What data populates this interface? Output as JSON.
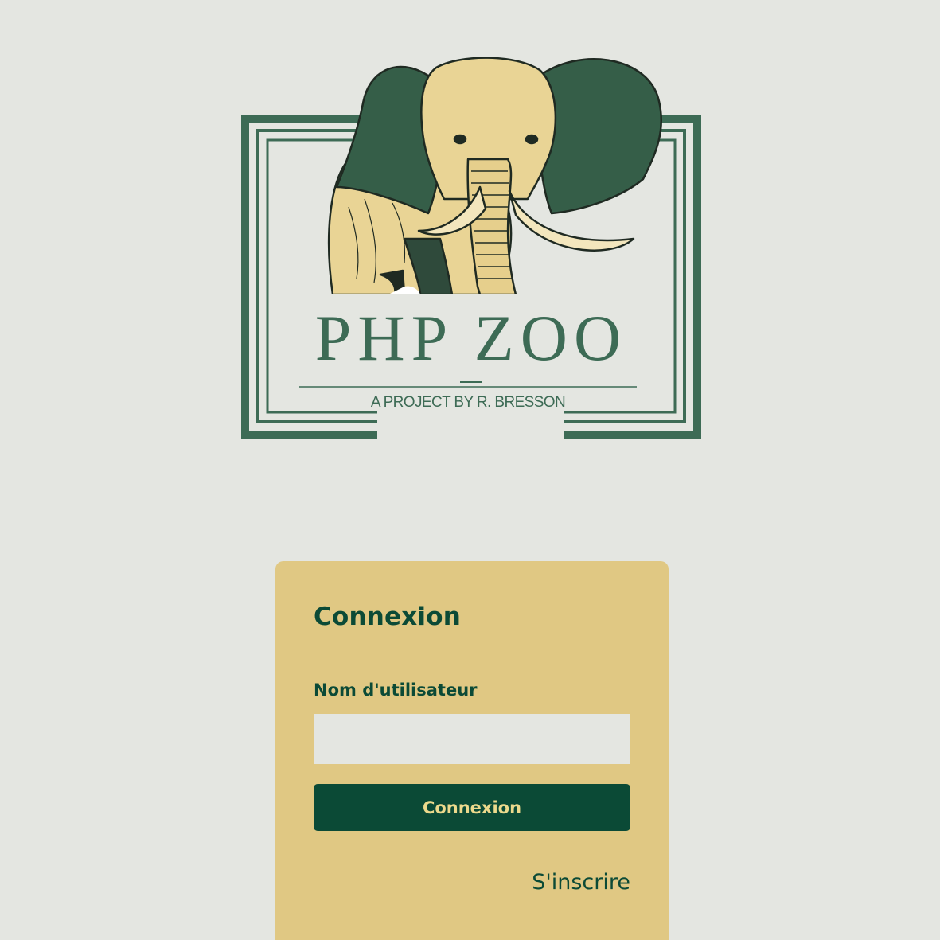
{
  "logo": {
    "title": "PHP ZOO",
    "subtitle": "A PROJECT BY R. BRESSON",
    "colors": {
      "frame": "#3d6b55",
      "ears": "#355e48",
      "body": "#e9d495",
      "outline": "#1f2a22"
    }
  },
  "login": {
    "title": "Connexion",
    "username_label": "Nom d'utilisateur",
    "username_value": "",
    "submit_label": "Connexion",
    "register_label": "S'inscrire"
  },
  "colors": {
    "background": "#e4e6e1",
    "card": "#e0c883",
    "accent": "#0b4a36",
    "button_text": "#ecd98c"
  }
}
